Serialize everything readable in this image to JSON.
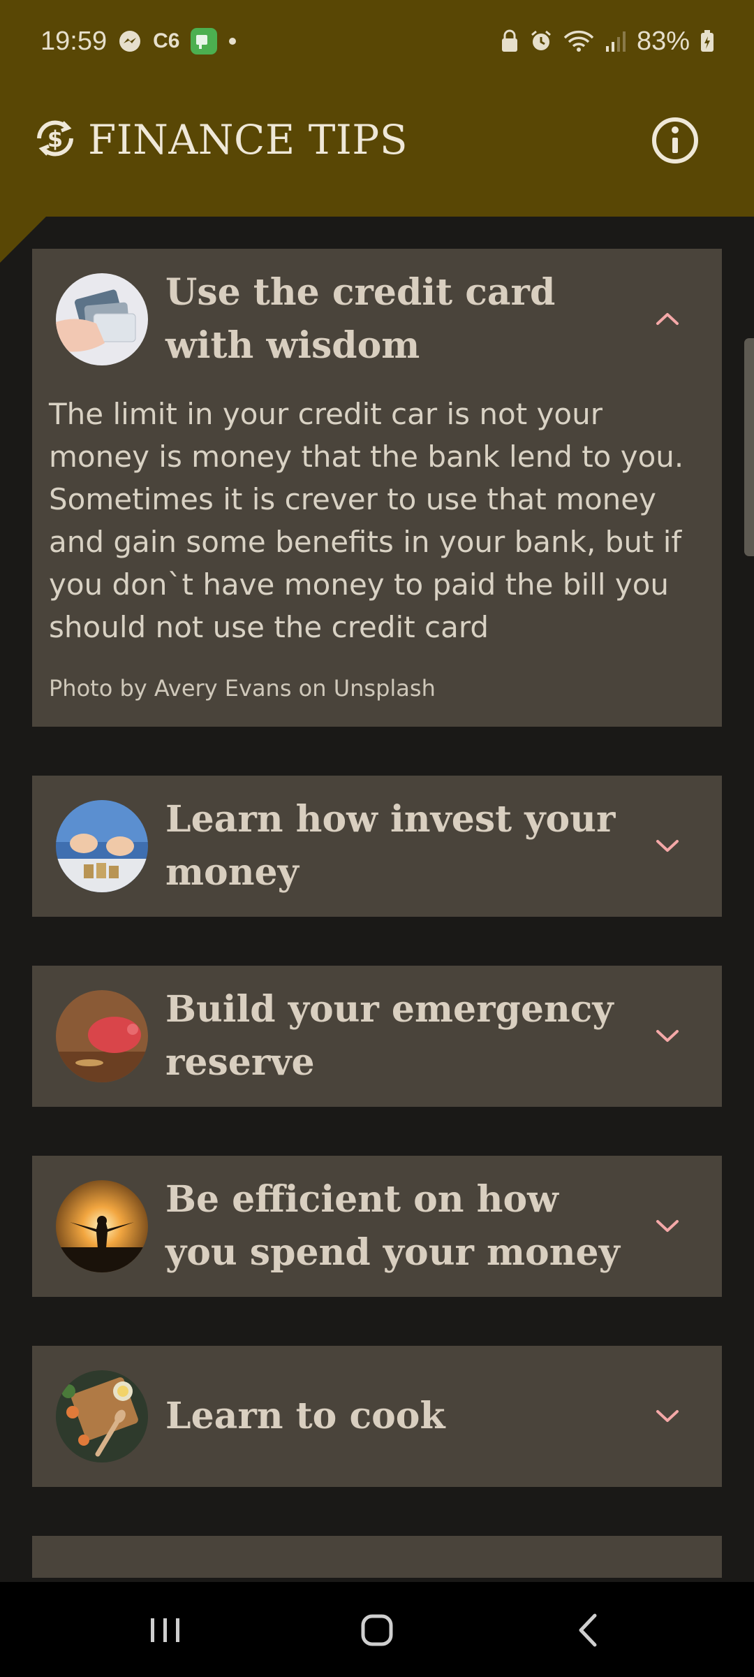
{
  "status_bar": {
    "time": "19:59",
    "carrier_badge": "C6",
    "battery": "83%",
    "icons": [
      "messenger-icon",
      "c6-icon",
      "picpay-icon",
      "dot-icon",
      "lock-icon",
      "alarm-icon",
      "wifi-icon",
      "signal-icon",
      "battery-icon"
    ]
  },
  "app_bar": {
    "title": "FINANCE TIPS",
    "logo_icon": "dollar-refresh-icon",
    "info_icon": "info-icon",
    "background": "#594705"
  },
  "cards": [
    {
      "title": "Use the credit card with wisdom",
      "expanded": true,
      "image": "credit-cards-photo",
      "body": "The limit in your credit car is not your money is money that the bank lend to you. Sometimes it is crever to use that money and gain some benefits in your bank, but if you don`t have money to paid the bill you should not use the credit card",
      "credit": "Photo by Avery Evans on Unsplash"
    },
    {
      "title": "Learn how invest your money",
      "expanded": false,
      "image": "coins-stack-photo"
    },
    {
      "title": "Build your emergency reserve",
      "expanded": false,
      "image": "piggy-bank-photo"
    },
    {
      "title": "Be efficient on how you spend your money",
      "expanded": false,
      "image": "sunset-silhouette-photo"
    },
    {
      "title": "Learn to cook",
      "expanded": false,
      "image": "cooking-ingredients-photo"
    }
  ],
  "colors": {
    "card_bg": "#4a443b",
    "page_bg": "#1a1917",
    "chevron": "#f4a8a8",
    "title_text": "#d9cfc0"
  },
  "nav_bar": {
    "items": [
      "recents-icon",
      "home-icon",
      "back-icon"
    ]
  }
}
